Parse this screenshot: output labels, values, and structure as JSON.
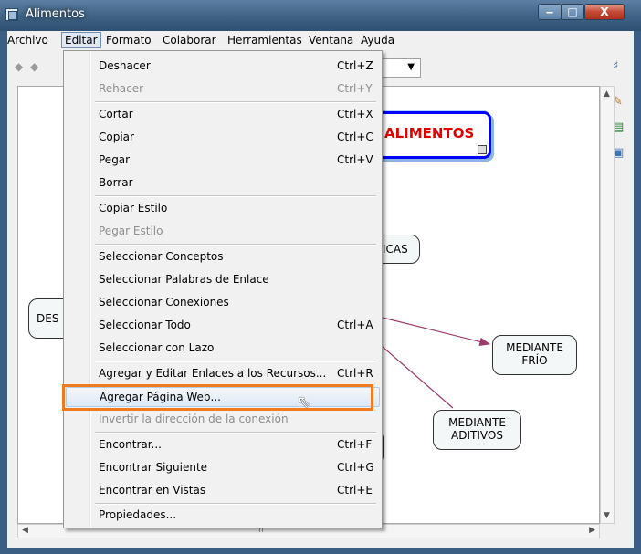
{
  "window": {
    "title": "Alimentos"
  },
  "menubar": {
    "items": [
      "Archivo",
      "Editar",
      "Formato",
      "Colaborar",
      "Herramientas",
      "Ventana",
      "Ayuda"
    ]
  },
  "edit_menu": {
    "items": [
      {
        "label": "Deshacer",
        "shortcut": "Ctrl+Z",
        "enabled": true
      },
      {
        "label": "Rehacer",
        "shortcut": "Ctrl+Y",
        "enabled": false
      },
      {
        "label": "Cortar",
        "shortcut": "Ctrl+X",
        "enabled": true
      },
      {
        "label": "Copiar",
        "shortcut": "Ctrl+C",
        "enabled": true
      },
      {
        "label": "Pegar",
        "shortcut": "Ctrl+V",
        "enabled": true
      },
      {
        "label": "Borrar",
        "shortcut": "",
        "enabled": true
      },
      {
        "label": "Copiar Estilo",
        "shortcut": "",
        "enabled": true
      },
      {
        "label": "Pegar Estilo",
        "shortcut": "",
        "enabled": false
      },
      {
        "label": "Seleccionar Conceptos",
        "shortcut": "",
        "enabled": true
      },
      {
        "label": "Seleccionar Palabras de Enlace",
        "shortcut": "",
        "enabled": true
      },
      {
        "label": "Seleccionar Conexiones",
        "shortcut": "",
        "enabled": true
      },
      {
        "label": "Seleccionar Todo",
        "shortcut": "Ctrl+A",
        "enabled": true
      },
      {
        "label": "Seleccionar con Lazo",
        "shortcut": "",
        "enabled": true
      },
      {
        "label": "Agregar y Editar Enlaces a los Recursos...",
        "shortcut": "Ctrl+R",
        "enabled": true
      },
      {
        "label": "Agregar Página Web...",
        "shortcut": "",
        "enabled": true
      },
      {
        "label": "Invertir la dirección de la conexión",
        "shortcut": "",
        "enabled": false
      },
      {
        "label": "Encontrar...",
        "shortcut": "Ctrl+F",
        "enabled": true
      },
      {
        "label": "Encontrar Siguiente",
        "shortcut": "Ctrl+G",
        "enabled": true
      },
      {
        "label": "Encontrar en Vistas",
        "shortcut": "Ctrl+E",
        "enabled": true
      },
      {
        "label": "Propiedades...",
        "shortcut": "",
        "enabled": true
      }
    ]
  },
  "concept_map": {
    "main_node": "ALIMENTOS",
    "nodes": {
      "partial_top": "ICAS",
      "partial_left": "DES",
      "frio_line1": "MEDIANTE",
      "frio_line2": "FRÍO",
      "aditivos_line1": "MEDIANTE",
      "aditivos_line2": "ADITIVOS"
    }
  },
  "colors": {
    "highlight_box": "#f07a1e",
    "link_line": "#9c3a6b",
    "main_node_border": "#0000ff",
    "main_node_text": "#e00000"
  },
  "icons": {
    "nav_back": "arrow-left-icon",
    "nav_forward": "arrow-right-icon",
    "side_tools": [
      "tool-icon",
      "paint-icon",
      "document-icon",
      "users-icon"
    ]
  }
}
